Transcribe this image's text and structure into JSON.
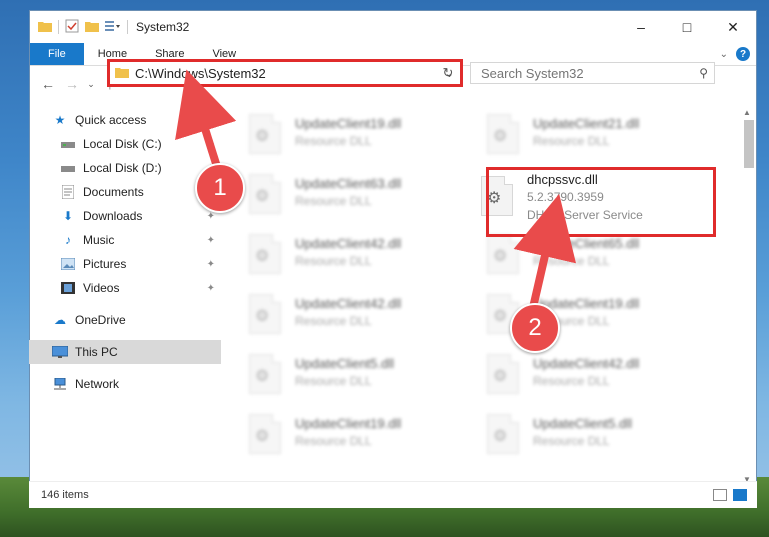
{
  "window": {
    "title": "System32"
  },
  "ribbon": {
    "tabs": [
      "File",
      "Home",
      "Share",
      "View"
    ]
  },
  "address": {
    "path": "C:\\Windows\\System32"
  },
  "search": {
    "placeholder": "Search System32"
  },
  "sidebar": {
    "items": [
      {
        "label": "Quick access",
        "icon": "star-icon",
        "pinned": false
      },
      {
        "label": "Local Disk (C:)",
        "icon": "drive-icon",
        "pinned": true
      },
      {
        "label": "Local Disk (D:)",
        "icon": "drive-icon",
        "pinned": true
      },
      {
        "label": "Documents",
        "icon": "documents-icon",
        "pinned": true
      },
      {
        "label": "Downloads",
        "icon": "download-arrow-icon",
        "pinned": true
      },
      {
        "label": "Music",
        "icon": "music-note-icon",
        "pinned": true
      },
      {
        "label": "Pictures",
        "icon": "pictures-icon",
        "pinned": true
      },
      {
        "label": "Videos",
        "icon": "film-icon",
        "pinned": true
      },
      {
        "label": "OneDrive",
        "icon": "cloud-icon",
        "pinned": false
      },
      {
        "label": "This PC",
        "icon": "monitor-icon",
        "pinned": false
      },
      {
        "label": "Network",
        "icon": "network-icon",
        "pinned": false
      }
    ]
  },
  "files": {
    "col1": [
      {
        "name": "UpdateClient19.dll",
        "type": "Resource DLL"
      },
      {
        "name": "UpdateClient63.dll",
        "type": "Resource DLL"
      },
      {
        "name": "UpdateClient42.dll",
        "type": "Resource DLL"
      },
      {
        "name": "UpdateClient42.dll",
        "type": "Resource DLL"
      },
      {
        "name": "UpdateClient5.dll",
        "type": "Resource DLL"
      },
      {
        "name": "UpdateClient19.dll",
        "type": "Resource DLL"
      }
    ],
    "col2": [
      {
        "name": "UpdateClient21.dll",
        "type": "Resource DLL"
      },
      {
        "name": "UpdateClient65.dll",
        "type": "Resource DLL"
      },
      {
        "name": "UpdateClient19.dll",
        "type": "Resource DLL"
      },
      {
        "name": "UpdateClient42.dll",
        "type": "Resource DLL"
      },
      {
        "name": "UpdateClient5.dll",
        "type": "Resource DLL"
      }
    ],
    "highlighted": {
      "name": "dhcpssvc.dll",
      "version": "5.2.3790.3959",
      "description": "DHCP Server Service"
    }
  },
  "status": {
    "item_count": "146 items"
  },
  "markers": {
    "one": "1",
    "two": "2"
  },
  "colors": {
    "accent": "#1979ca",
    "highlight": "#e02b2b",
    "marker": "#e94b4b"
  }
}
